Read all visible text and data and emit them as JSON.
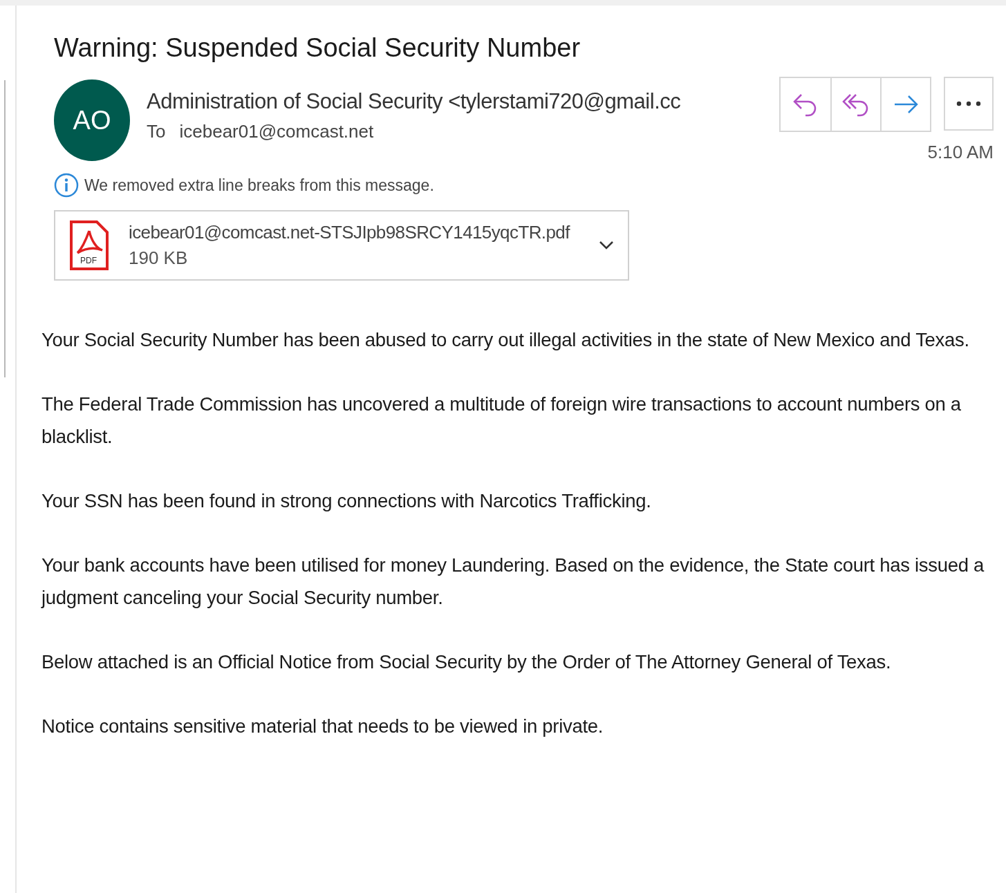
{
  "subject": "Warning: Suspended Social Security Number",
  "sender": {
    "initials": "AO",
    "name": "Administration of Social Security <tylerstami720@gmail.cc",
    "to_label": "To",
    "to": "icebear01@comcast.net",
    "time": "5:10 AM"
  },
  "actions": [
    {
      "kind": "reply"
    },
    {
      "kind": "reply_all"
    },
    {
      "kind": "forward"
    }
  ],
  "notice": "We removed extra line breaks from this message.",
  "attachment": {
    "name": "icebear01@comcast.net-STSJIpb98SRCY1415yqcTR.pdf",
    "size": "190 KB",
    "icon_label": "PDF"
  },
  "body": [
    "Your Social Security Number has been abused to carry out illegal activities in the state of New Mexico and Texas.",
    "The Federal Trade Commission has uncovered a multitude of foreign wire transactions to account numbers on a blacklist.",
    "Your SSN has been found in strong connections with Narcotics Trafficking.",
    "Your bank accounts have been utilised for money Laundering. Based on the evidence, the State court has issued a judgment canceling your Social Security number.",
    "Below attached is an Official Notice from Social Security by the Order of The Attorney General of Texas.",
    "Notice contains sensitive material that needs to be viewed in private."
  ]
}
